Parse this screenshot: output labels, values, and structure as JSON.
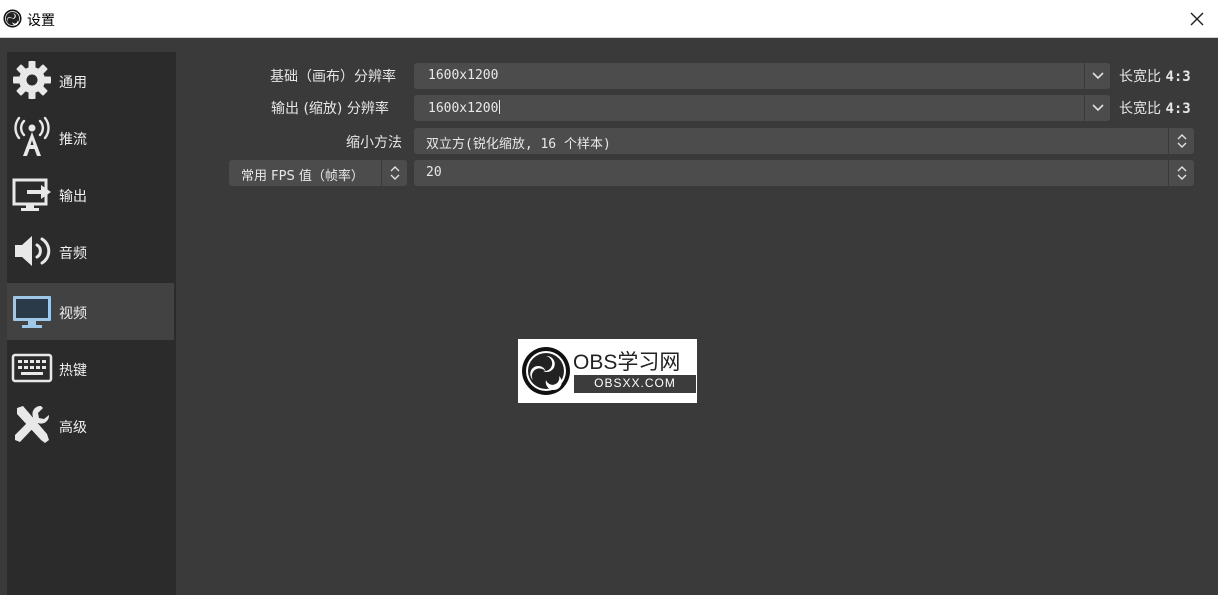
{
  "window": {
    "title": "设置",
    "close_icon": "close-icon",
    "app_icon": "obs-logo-icon"
  },
  "sidebar": {
    "items": [
      {
        "label": "通用",
        "icon": "gear-icon",
        "active": false
      },
      {
        "label": "推流",
        "icon": "broadcast-antenna-icon",
        "active": false
      },
      {
        "label": "输出",
        "icon": "output-monitor-icon",
        "active": false
      },
      {
        "label": "音频",
        "icon": "speaker-icon",
        "active": false
      },
      {
        "label": "视频",
        "icon": "monitor-icon",
        "active": true
      },
      {
        "label": "热键",
        "icon": "keyboard-icon",
        "active": false
      },
      {
        "label": "高级",
        "icon": "tools-icon",
        "active": false
      }
    ]
  },
  "video": {
    "base_resolution": {
      "label": "基础（画布）分辨率",
      "value": "1600x1200",
      "aspect_label": "长宽比",
      "aspect_value": "4:3"
    },
    "output_resolution": {
      "label": "输出 (缩放) 分辨率",
      "value": "1600x1200",
      "aspect_label": "长宽比",
      "aspect_value": "4:3"
    },
    "downscale_filter": {
      "label": "缩小方法",
      "value": "双立方(锐化缩放, 16 个样本)"
    },
    "fps": {
      "label": "常用 FPS 值（帧率）",
      "value": "20"
    }
  },
  "watermark": {
    "title": "OBS学习网",
    "subtitle": "OBSXX.COM"
  },
  "colors": {
    "background": "#3a3a3a",
    "sidebar": "#2b2b2b",
    "sidebar_active": "#424242",
    "field": "#4c4c4c",
    "text": "#e6e6e6",
    "active_icon": "#9fc8e8"
  }
}
